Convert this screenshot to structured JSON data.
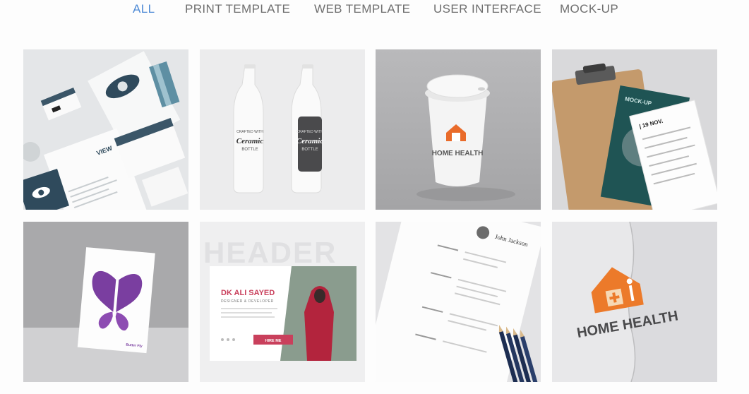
{
  "filters": [
    {
      "label": "ALL",
      "active": true
    },
    {
      "label": "PRINT TEMPLATE",
      "active": false
    },
    {
      "label": "WEB TEMPLATE",
      "active": false
    },
    {
      "label": "USER INTERFACE",
      "active": false
    },
    {
      "label": "MOCK-UP",
      "active": false
    }
  ],
  "colors": {
    "active_filter": "#4f8bd6",
    "inactive_filter": "#6e6e6e",
    "brand_orange": "#e96b2a",
    "accent_pink": "#c9405c"
  },
  "tiles": {
    "stationery": {
      "brand": "VIEW"
    },
    "bottles": {
      "line1": "CRAFTED WITH",
      "main": "Ceramic",
      "line2": "BOTTLE"
    },
    "cup": {
      "logo_text": "HOME HEALTH"
    },
    "clipboard": {
      "date": "| 19 NOV.",
      "poster": "MOCK-UP"
    },
    "butterfly": {
      "brand": "Butter Fly"
    },
    "web_header": {
      "bg_word": "HEADER",
      "name": "DK ALI SAYED",
      "role": "DESIGNER & DEVELOPER",
      "cta": "HIRE ME"
    },
    "resume": {
      "name": "John Jackson"
    },
    "paper_logo": {
      "logo_text": "HOME HEALTH"
    }
  }
}
